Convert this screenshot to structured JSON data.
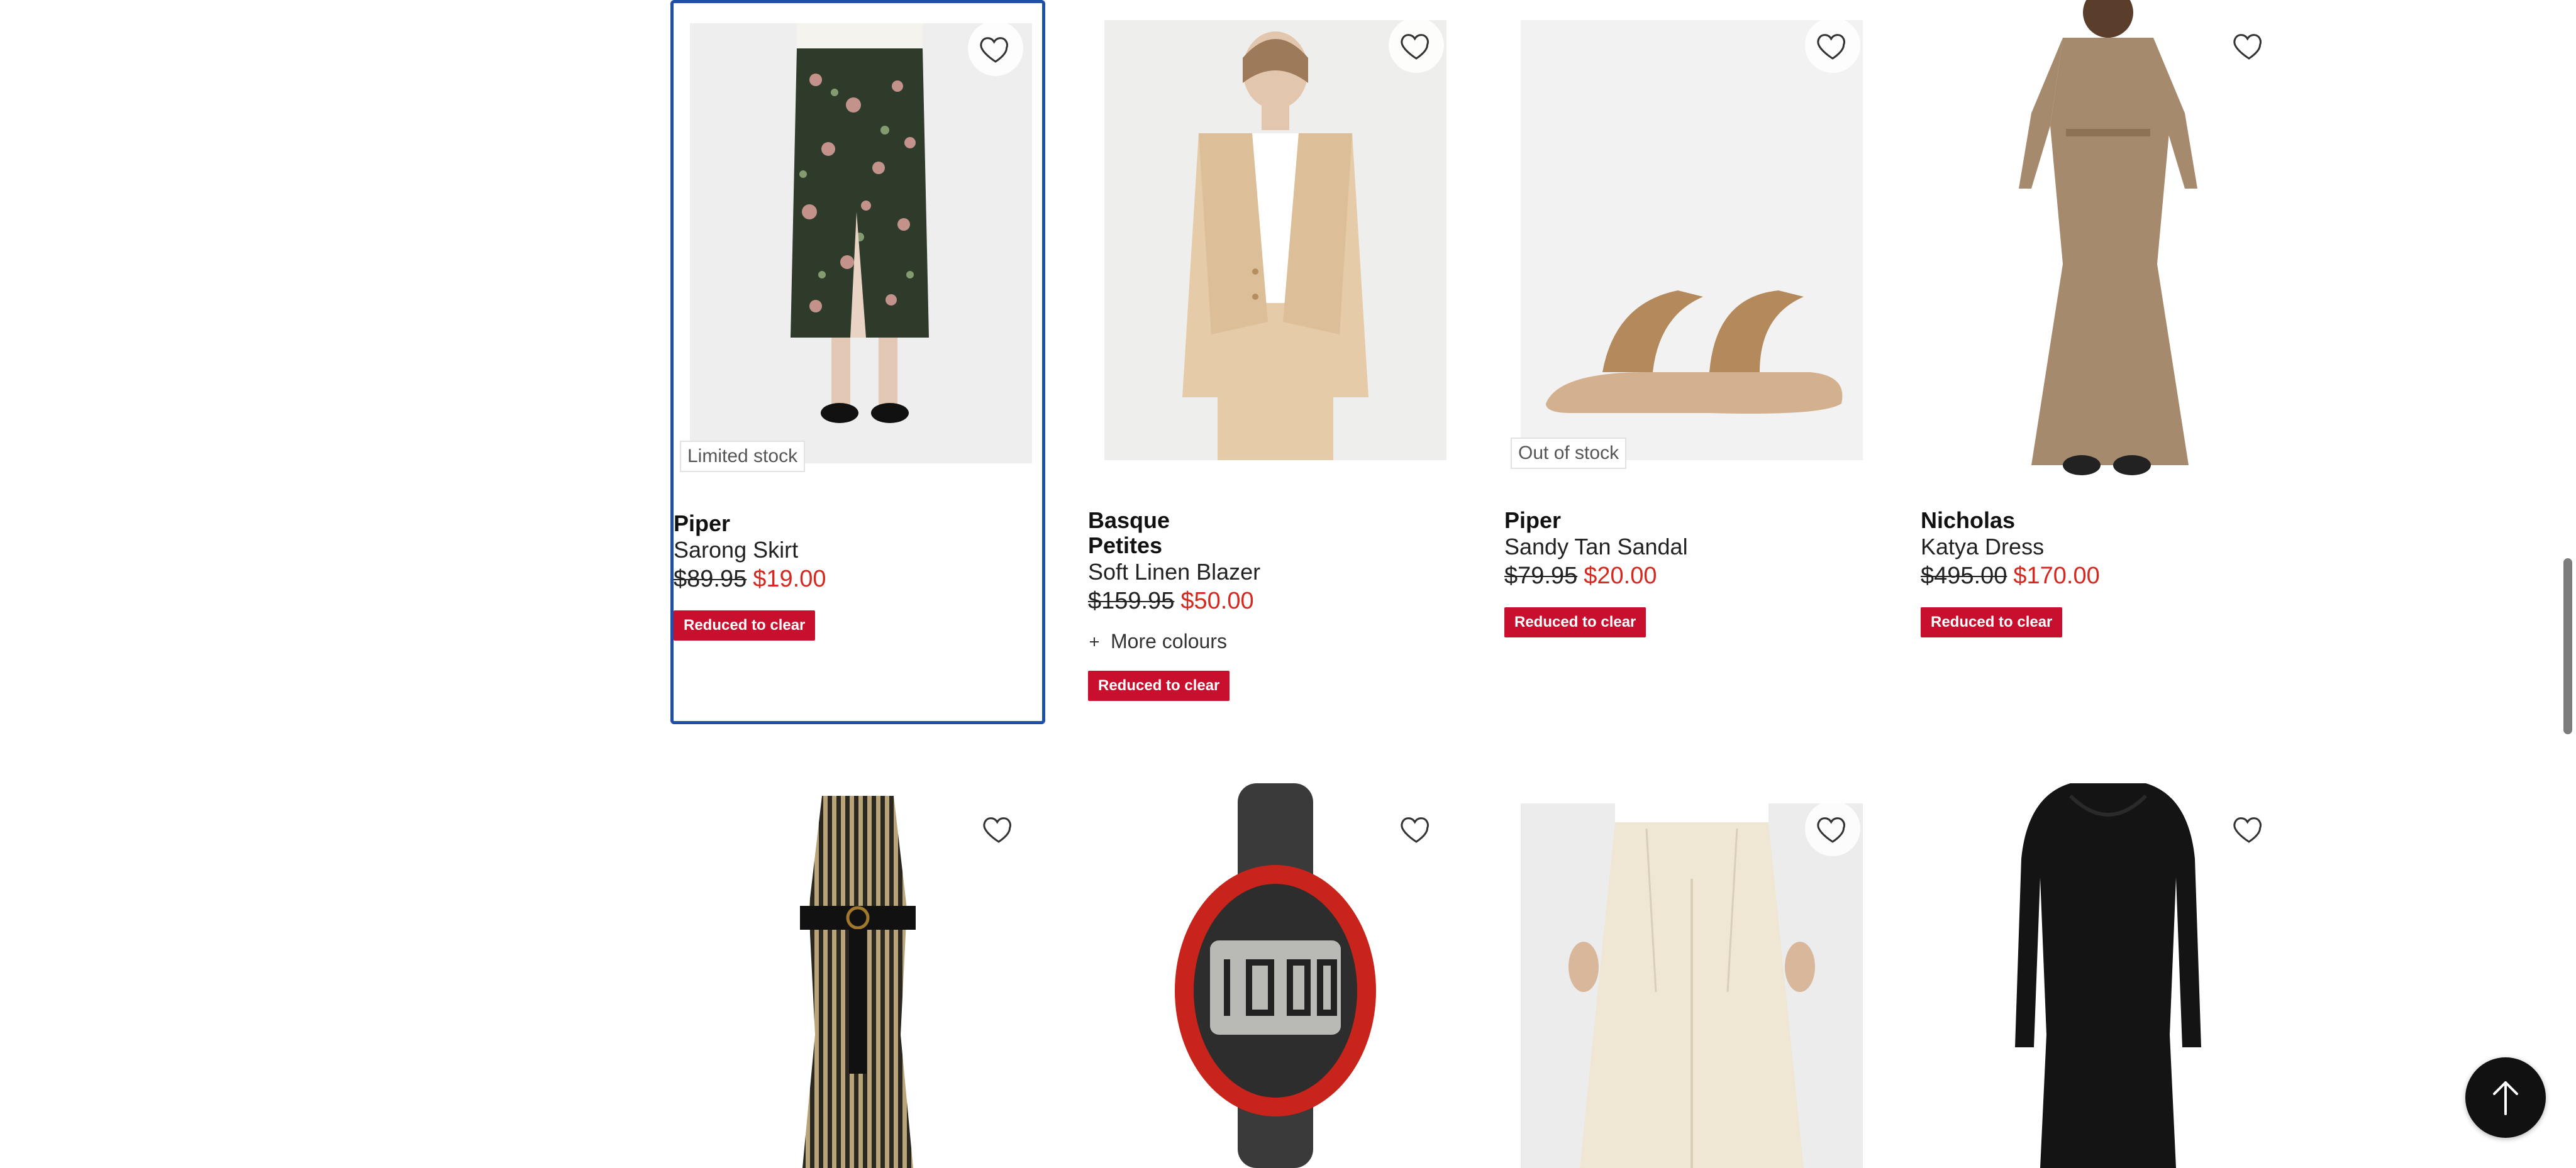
{
  "products": [
    {
      "brand": "Piper",
      "brand2": "",
      "name": "Sarong Skirt",
      "was": "$89.95",
      "now": "$19.00",
      "badge": "Limited stock",
      "tag": "Reduced to clear",
      "more": ""
    },
    {
      "brand": "Basque",
      "brand2": "Petites",
      "name": "Soft Linen Blazer",
      "was": "$159.95",
      "now": "$50.00",
      "badge": "",
      "tag": "Reduced to clear",
      "more": "More colours"
    },
    {
      "brand": "Piper",
      "brand2": "",
      "name": "Sandy Tan Sandal",
      "was": "$79.95",
      "now": "$20.00",
      "badge": "Out of stock",
      "tag": "Reduced to clear",
      "more": ""
    },
    {
      "brand": "Nicholas",
      "brand2": "",
      "name": "Katya Dress",
      "was": "$495.00",
      "now": "$170.00",
      "badge": "",
      "tag": "Reduced to clear",
      "more": ""
    }
  ],
  "second_row": [
    {
      "image": "striped-halter-dress"
    },
    {
      "image": "red-digital-watch"
    },
    {
      "image": "cream-wide-leg-pants"
    },
    {
      "image": "black-long-sleeve-dress"
    }
  ],
  "icons": {
    "wishlist": "heart-icon",
    "more_colours": "plus-icon",
    "scroll_top": "arrow-up-icon"
  },
  "colors": {
    "sale_price": "#d6281f",
    "reduced_tag": "#c8102e",
    "selected_border": "#1f4fa6"
  }
}
